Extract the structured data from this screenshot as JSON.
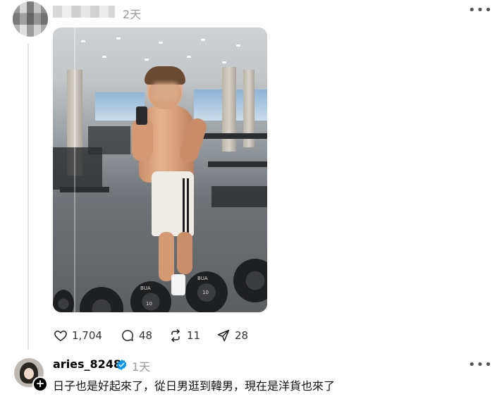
{
  "post1": {
    "time": "2天",
    "more_icon": "more-icon",
    "stats": {
      "likes": "1,704",
      "comments": "48",
      "reposts": "11",
      "shares": "28"
    },
    "photo_plate_labels": [
      "BUA",
      "10",
      "BUA",
      "10"
    ]
  },
  "post2": {
    "username": "aries_8248",
    "time": "1天",
    "text": "日子也是好起來了，從日男逛到韓男，現在是洋貨也來了",
    "verified_color": "#0095f6"
  },
  "colors": {
    "muted": "#999999",
    "thread_line": "#e6e6e6"
  }
}
